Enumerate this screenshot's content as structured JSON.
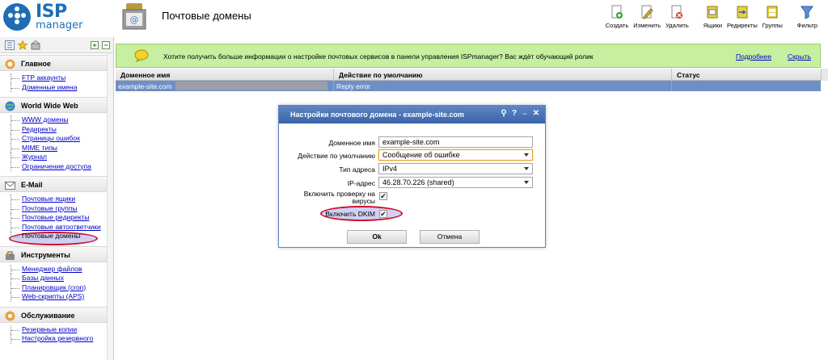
{
  "header": {
    "logo_text": "ISP",
    "logo_subtext": "manager",
    "page_title": "Почтовые домены"
  },
  "toolbar": [
    {
      "label": "Создать",
      "icon": "create-icon"
    },
    {
      "label": "Изменить",
      "icon": "edit-icon"
    },
    {
      "label": "Удалить",
      "icon": "delete-icon"
    },
    {
      "label": "Ящики",
      "icon": "mailboxes-icon"
    },
    {
      "label": "Редиректы",
      "icon": "redirects-icon"
    },
    {
      "label": "Группы",
      "icon": "groups-icon"
    },
    {
      "label": "Фильтр",
      "icon": "filter-icon"
    }
  ],
  "sidebar": {
    "sections": [
      {
        "title": "Главное",
        "icon": "home-icon",
        "items": [
          "FTP аккаунты",
          "Доменные имена"
        ]
      },
      {
        "title": "World Wide Web",
        "icon": "globe-icon",
        "items": [
          "WWW домены",
          "Редиректы",
          "Страницы ошибок",
          "MIME типы",
          "Журнал",
          "Ограничение доступа"
        ]
      },
      {
        "title": "E-Mail",
        "icon": "mail-icon",
        "items": [
          "Почтовые ящики",
          "Почтовые группы",
          "Почтовые редиректы",
          "Почтовые автоответчики",
          "Почтовые домены"
        ]
      },
      {
        "title": "Инструменты",
        "icon": "tools-icon",
        "items": [
          "Менеджер файлов",
          "Базы данных",
          "Планировщик (cron)",
          "Web-скрипты (APS)"
        ]
      },
      {
        "title": "Обслуживание",
        "icon": "service-icon",
        "items": [
          "Резервные копии",
          "Настройка резервного"
        ]
      }
    ]
  },
  "banner": {
    "text": "Хотите получить больше информации о настройке почтовых сервисов в панели управления ISPmanager? Вас ждёт обучающий ролик",
    "more_link": "Подробнее",
    "hide_link": "Скрыть"
  },
  "grid": {
    "columns": [
      "Доменное имя",
      "Действие по умолчанию",
      "Статус"
    ],
    "rows": [
      [
        "example-site.com",
        "Reply error",
        ""
      ]
    ]
  },
  "dialog": {
    "title": "Настройки почтового домена - example-site.com",
    "fields": {
      "domain_label": "Доменное имя",
      "domain_value": "example-site.com",
      "action_label": "Действие по умолчанию",
      "action_value": "Сообщение об ошибке",
      "addr_type_label": "Тип адреса",
      "addr_type_value": "IPv4",
      "ip_label": "IP-адрес",
      "ip_value": "46.28.70.226 (shared)",
      "antivirus_label_line1": "Включить проверку на",
      "antivirus_label_line2": "вирусы",
      "dkim_label": "Включить DKIM"
    },
    "ok_label": "Ok",
    "cancel_label": "Отмена"
  }
}
